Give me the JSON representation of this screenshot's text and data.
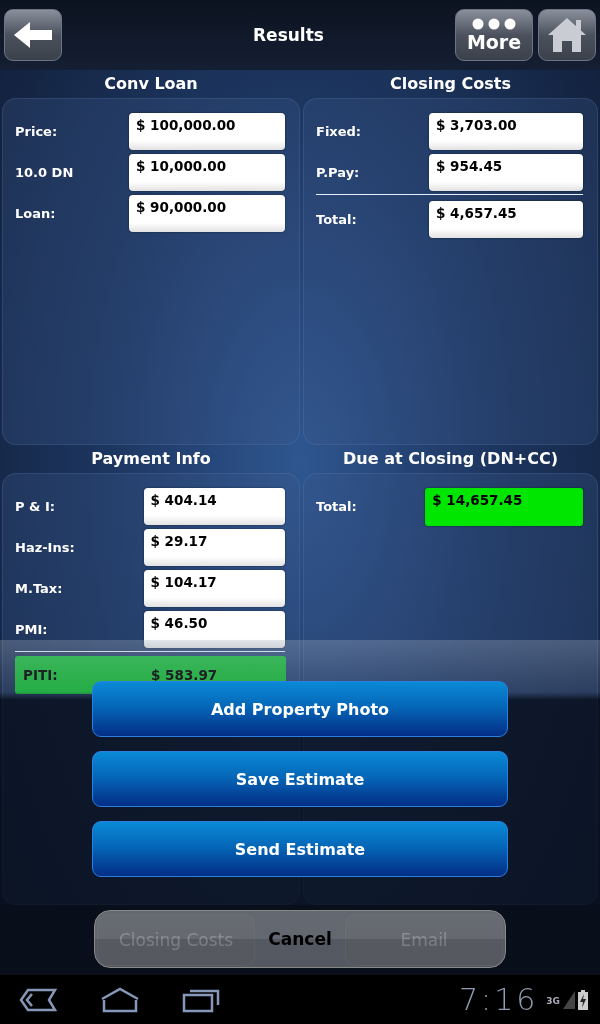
{
  "header": {
    "title": "Results",
    "more_button": "More"
  },
  "sections": [
    {
      "title": "Conv Loan",
      "rows": [
        {
          "kind": "field",
          "label": "Price:",
          "value": "$ 100,000.00"
        },
        {
          "kind": "field",
          "label": "10.0 DN",
          "value": "$ 10,000.00"
        },
        {
          "kind": "field",
          "label": "Loan:",
          "value": "$ 90,000.00"
        }
      ]
    },
    {
      "title": "Closing Costs",
      "rows": [
        {
          "kind": "field",
          "label": "Fixed:",
          "value": "$ 3,703.00"
        },
        {
          "kind": "field",
          "label": "P.Pay:",
          "value": "$ 954.45"
        },
        {
          "kind": "total",
          "label": "Total:",
          "value": "$ 4,657.45"
        }
      ]
    },
    {
      "title": "Payment Info",
      "rows": [
        {
          "kind": "field",
          "label": "P & I:",
          "value": "$ 404.14"
        },
        {
          "kind": "field",
          "label": "Haz-Ins:",
          "value": "$ 29.17"
        },
        {
          "kind": "field",
          "label": "M.Tax:",
          "value": "$ 104.17"
        },
        {
          "kind": "field",
          "label": "PMI:",
          "value": "$ 46.50"
        },
        {
          "kind": "summary",
          "label": "PITI:",
          "value": "$ 583.97"
        }
      ]
    },
    {
      "title": "Due at Closing (DN+CC)",
      "rows": [
        {
          "kind": "highlight",
          "label": "Total:",
          "value": "$ 14,657.45"
        }
      ]
    }
  ],
  "bottom_bar": {
    "buttons": [
      "Closing Costs",
      "Email"
    ]
  },
  "action_sheet": {
    "buttons": [
      "Add Property Photo",
      "Save Estimate",
      "Send Estimate"
    ],
    "cancel": "Cancel"
  },
  "status_bar": {
    "time": "7:16",
    "network": "3G"
  }
}
